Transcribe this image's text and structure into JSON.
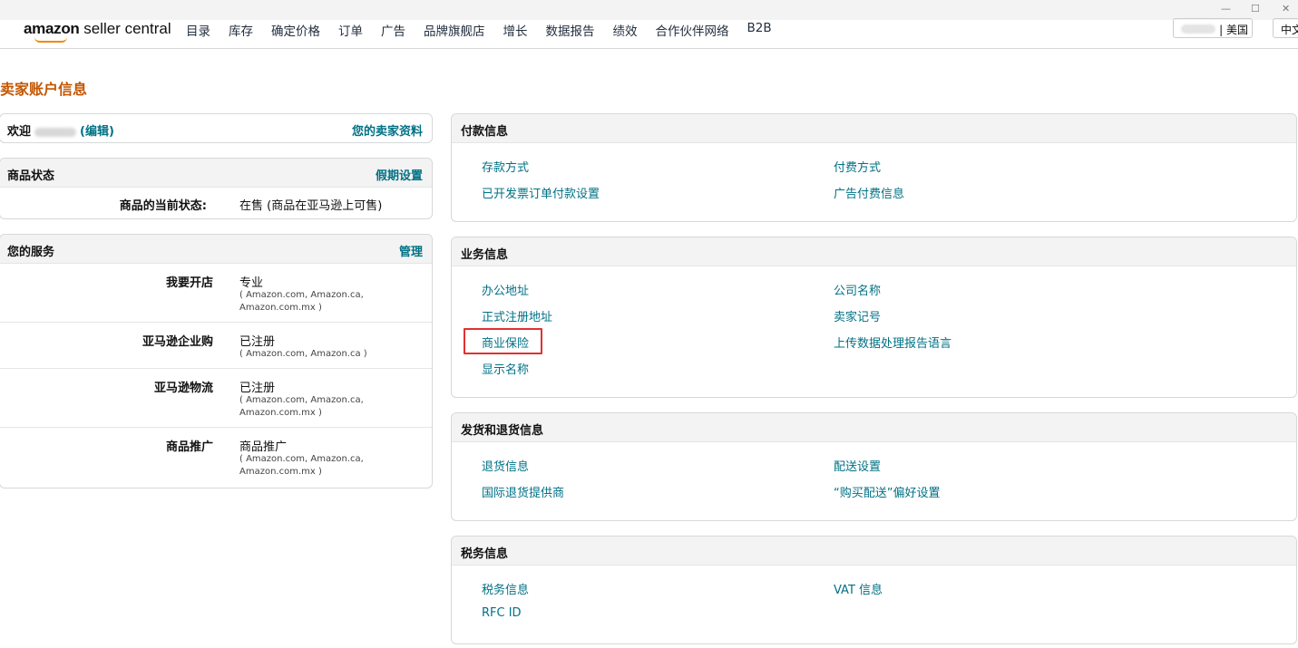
{
  "window": {
    "min": "—",
    "max": "☐",
    "close": "✕"
  },
  "nav": {
    "logo_amazon": "amazon",
    "logo_rest": " seller central",
    "items": [
      "目录",
      "库存",
      "确定价格",
      "订单",
      "广告",
      "品牌旗舰店",
      "增长",
      "数据报告",
      "绩效",
      "合作伙伴网络",
      "B2B"
    ],
    "marketplace": "| 美国",
    "language": "中文"
  },
  "page": {
    "title": "卖家账户信息"
  },
  "welcome": {
    "greeting": "欢迎",
    "edit": "(编辑)",
    "profile_link": "您的卖家资料"
  },
  "listing_status": {
    "title": "商品状态",
    "action": "假期设置",
    "label": "商品的当前状态:",
    "value": "在售 (商品在亚马逊上可售)"
  },
  "services": {
    "title": "您的服务",
    "action": "管理",
    "rows": [
      {
        "label": "我要开店",
        "value": "专业",
        "sub": "( Amazon.com, Amazon.ca, Amazon.com.mx )"
      },
      {
        "label": "亚马逊企业购",
        "value": "已注册",
        "sub": "( Amazon.com, Amazon.ca )"
      },
      {
        "label": "亚马逊物流",
        "value": "已注册",
        "sub": "( Amazon.com, Amazon.ca, Amazon.com.mx )"
      },
      {
        "label": "商品推广",
        "value": "商品推广",
        "sub": "( Amazon.com, Amazon.ca, Amazon.com.mx )"
      }
    ]
  },
  "payment": {
    "title": "付款信息",
    "links": [
      "存款方式",
      "付费方式",
      "已开发票订单付款设置",
      "广告付费信息"
    ]
  },
  "business": {
    "title": "业务信息",
    "links": [
      "办公地址",
      "公司名称",
      "正式注册地址",
      "卖家记号",
      "商业保险",
      "上传数据处理报告语言",
      "显示名称"
    ]
  },
  "shipping": {
    "title": "发货和退货信息",
    "links": [
      "退货信息",
      "配送设置",
      "国际退货提供商",
      "“购买配送”偏好设置"
    ]
  },
  "tax": {
    "title": "税务信息",
    "links": [
      "税务信息",
      "VAT 信息",
      "RFC ID"
    ]
  }
}
